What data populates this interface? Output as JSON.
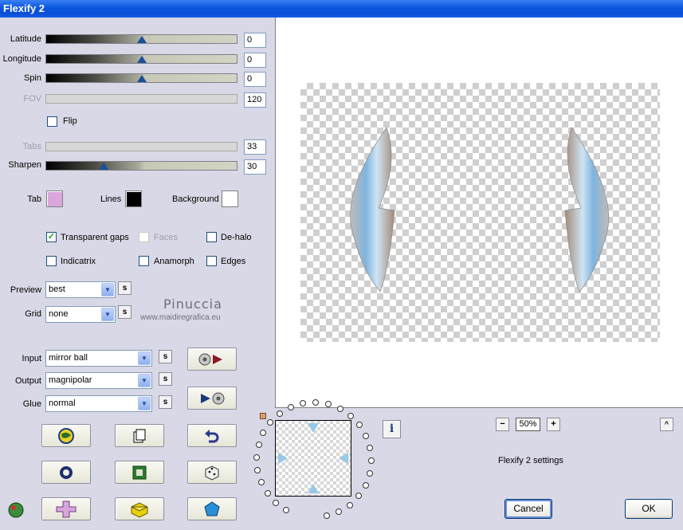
{
  "window": {
    "title": "Flexify 2"
  },
  "sliders": {
    "latitude": {
      "label": "Latitude",
      "value": "0",
      "level": 0.5
    },
    "longitude": {
      "label": "Longitude",
      "value": "0",
      "level": 0.5
    },
    "spin": {
      "label": "Spin",
      "value": "0",
      "level": 0.5
    },
    "fov": {
      "label": "FOV",
      "value": "120"
    },
    "tabs": {
      "label": "Tabs",
      "value": "33"
    },
    "sharpen": {
      "label": "Sharpen",
      "value": "30",
      "level": 0.3
    }
  },
  "flip": {
    "label": "Flip",
    "checked": false
  },
  "colors": {
    "tab": {
      "label": "Tab",
      "color": "#dba6db"
    },
    "lines": {
      "label": "Lines",
      "color": "#000000"
    },
    "background": {
      "label": "Background",
      "color": "#ffffff"
    }
  },
  "options": {
    "transparent_gaps": {
      "label": "Transparent gaps",
      "checked": true
    },
    "faces": {
      "label": "Faces",
      "checked": false
    },
    "de_halo": {
      "label": "De-halo",
      "checked": false
    },
    "indicatrix": {
      "label": "Indicatrix",
      "checked": false
    },
    "anamorph": {
      "label": "Anamorph",
      "checked": false
    },
    "edges": {
      "label": "Edges",
      "checked": false
    }
  },
  "preview": {
    "label": "Preview",
    "value": "best"
  },
  "grid": {
    "label": "Grid",
    "value": "none"
  },
  "watermark": {
    "name": "Pinuccia",
    "url": "www.maidiregrafica.eu"
  },
  "input": {
    "label": "Input",
    "value": "mirror ball"
  },
  "output": {
    "label": "Output",
    "value": "magnipolar"
  },
  "glue": {
    "label": "Glue",
    "value": "normal"
  },
  "s_button": "s",
  "zoom": {
    "minus": "−",
    "value": "50%",
    "plus": "+"
  },
  "status_text": "Flexify 2 settings",
  "info_icon": "i",
  "up_label": "^",
  "buttons": {
    "cancel": "Cancel",
    "ok": "OK"
  }
}
